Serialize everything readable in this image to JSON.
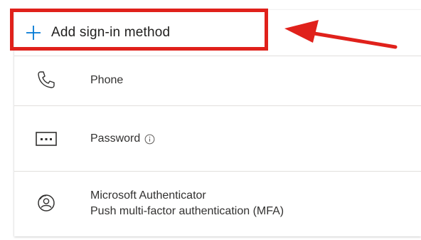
{
  "add_button": {
    "label": "Add sign-in method",
    "icon": "plus-icon"
  },
  "methods": [
    {
      "icon": "phone-icon",
      "title": "Phone"
    },
    {
      "icon": "password-icon",
      "title": "Password",
      "info_icon": "info-icon"
    },
    {
      "icon": "authenticator-icon",
      "title": "Microsoft Authenticator",
      "subtitle": "Push multi-factor authentication (MFA)"
    }
  ],
  "colors": {
    "highlight": "#e0211b",
    "accent": "#0078d4",
    "text": "#323130",
    "divider": "#e1dfdd"
  }
}
